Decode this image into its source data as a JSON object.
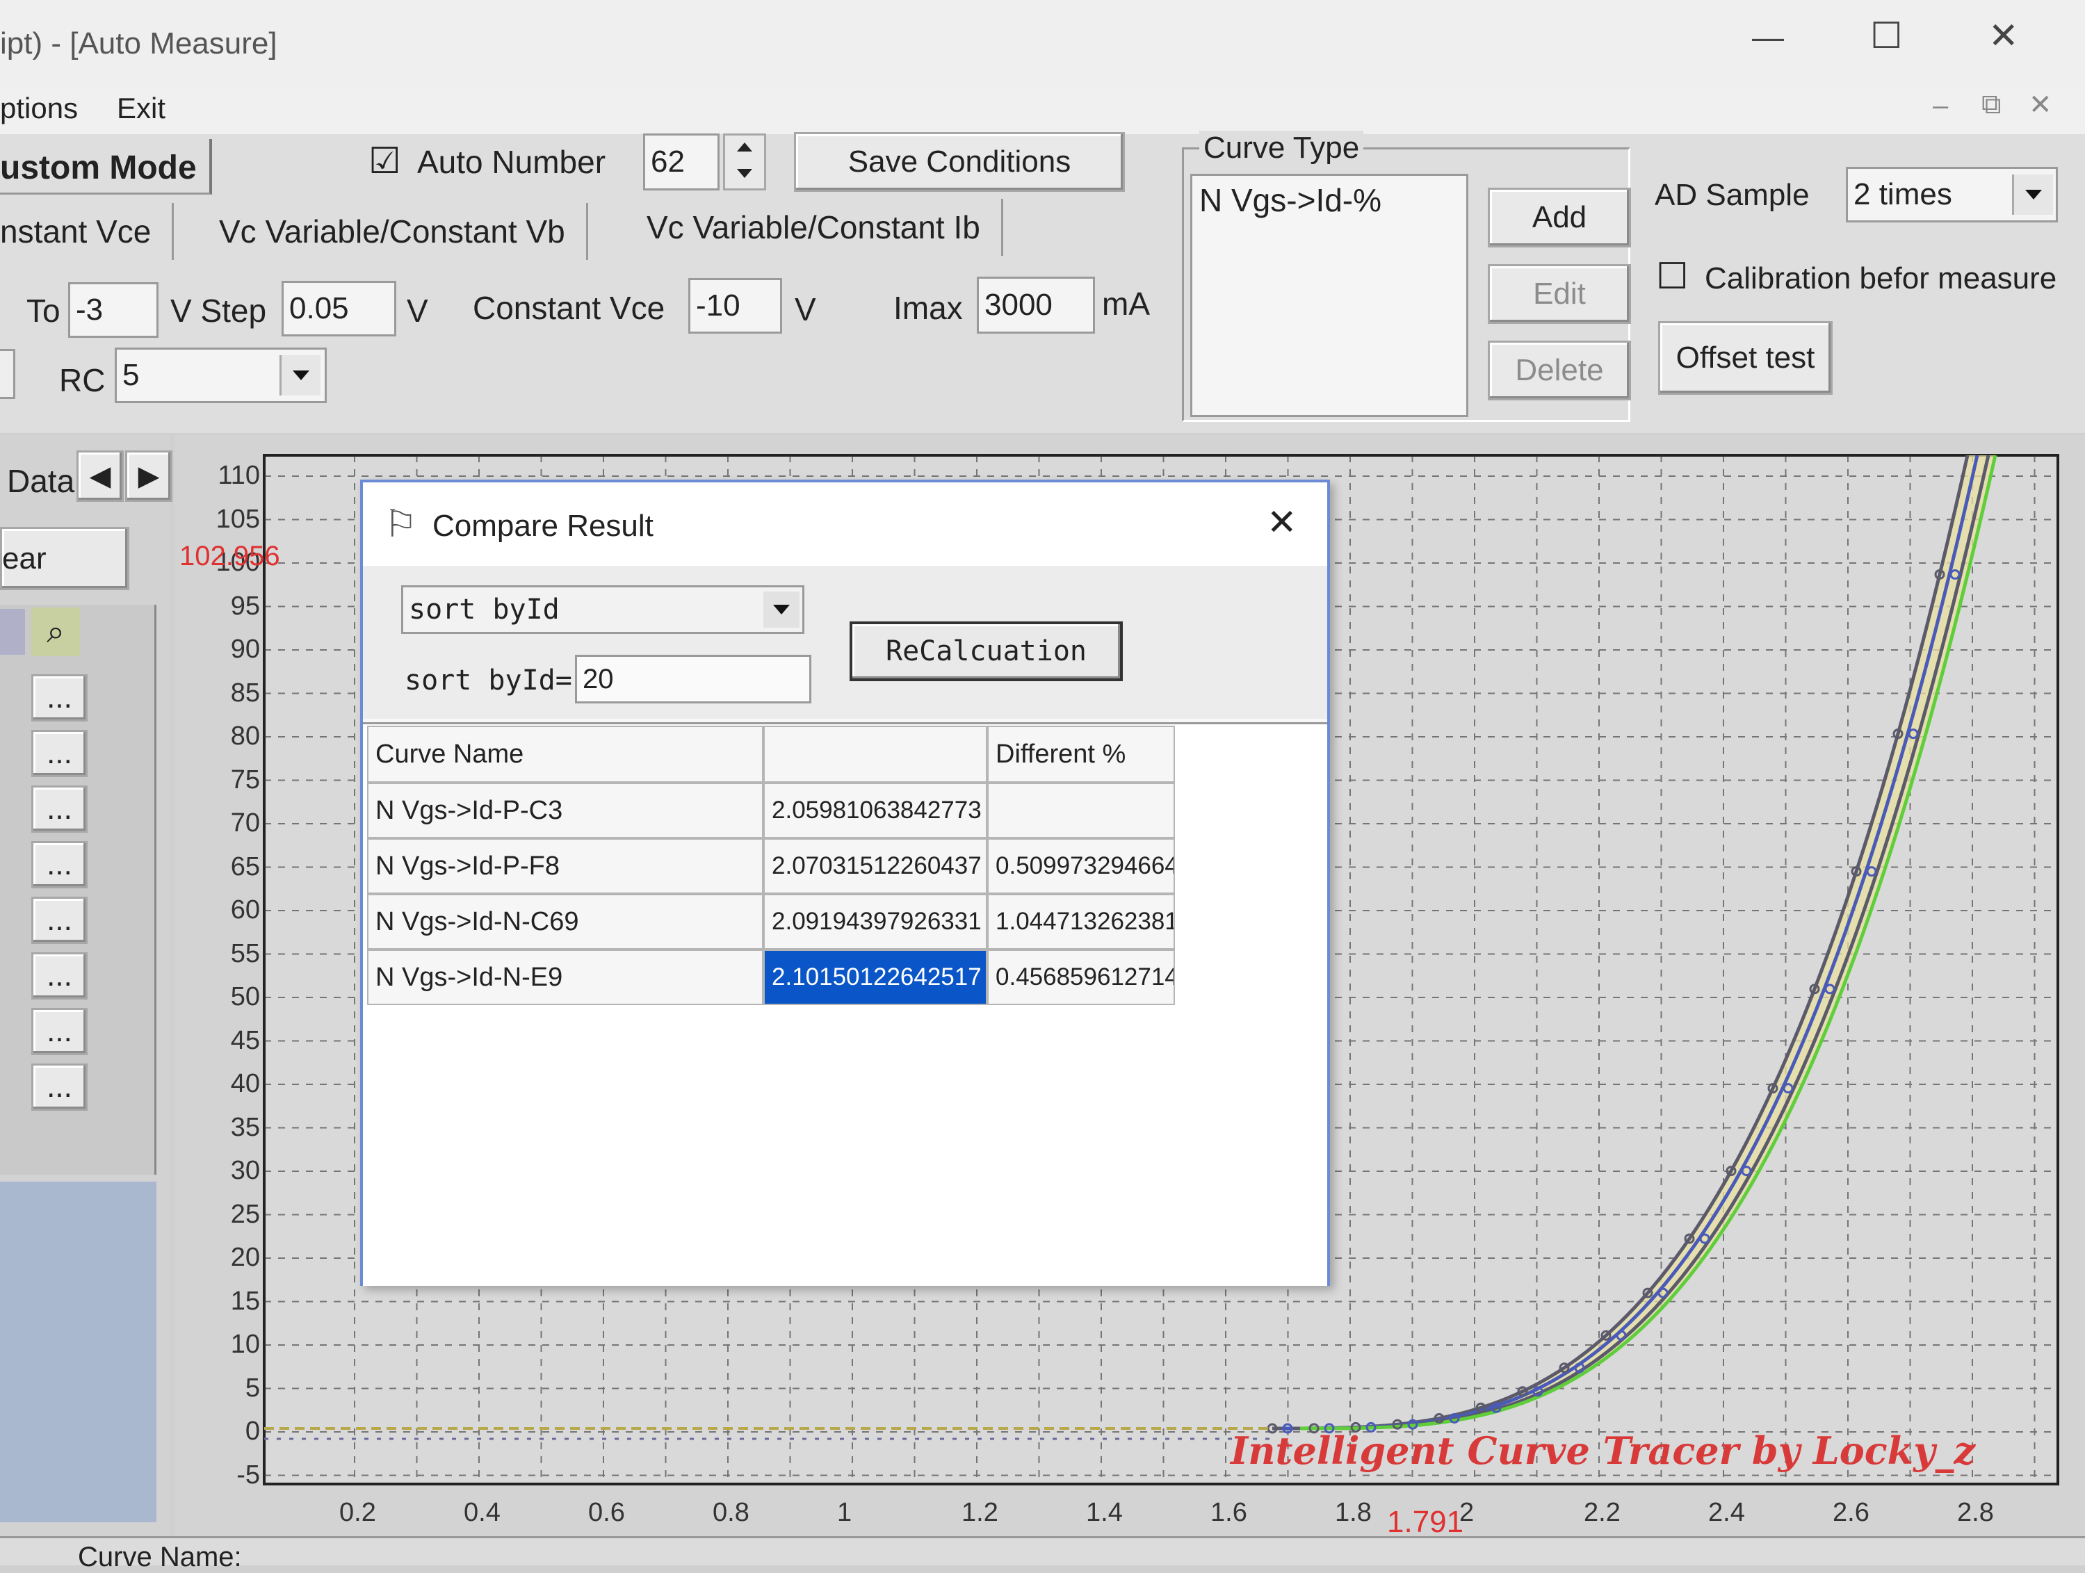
{
  "window": {
    "title": "ipt) - [Auto Measure]",
    "controls": {
      "minimize": "—",
      "maximize": "☐",
      "close": "✕"
    }
  },
  "menu": {
    "options": "ptions",
    "exit": "Exit"
  },
  "mdi_controls": {
    "minimize": "–",
    "restore": "⧉",
    "close": "✕"
  },
  "mode": {
    "label": "ustom Mode"
  },
  "auto_number": {
    "checkbox": "☑",
    "label": "Auto Number",
    "value": "62"
  },
  "save_conditions": "Save Conditions",
  "tabs": [
    "nstant Vce",
    "Vc Variable/Constant Vb",
    "Vc Variable/Constant Ib"
  ],
  "params": {
    "to_label": "To",
    "to_value": "-3",
    "step_label": "V Step",
    "step_value": "0.05",
    "step_unit": "V",
    "vce_label": "Constant Vce",
    "vce_value": "-10",
    "vce_unit": "V",
    "imax_label": "Imax",
    "imax_value": "3000",
    "imax_unit": "mA",
    "rc_label": "RC",
    "rc_value": "5"
  },
  "curve_type": {
    "title": "Curve Type",
    "items": [
      "N Vgs->Id-%"
    ],
    "add": "Add",
    "edit": "Edit",
    "delete": "Delete"
  },
  "ad_sample": {
    "label": "AD Sample",
    "value": "2 times"
  },
  "calibration": {
    "checkbox": "☐",
    "label": "Calibration befor measure"
  },
  "offset_test": "Offset test",
  "left_panel": {
    "data_label": "Data",
    "clear_label": "ear",
    "dots": "..."
  },
  "plot": {
    "y_marker": "102.956",
    "x_marker": "1.791",
    "watermark": "Intelligent Curve Tracer by Locky_z",
    "y_ticks": [
      "110",
      "105",
      "100",
      "95",
      "90",
      "85",
      "80",
      "75",
      "70",
      "65",
      "60",
      "55",
      "50",
      "45",
      "40",
      "35",
      "30",
      "25",
      "20",
      "15",
      "10",
      "5",
      "0",
      "-5"
    ],
    "x_ticks": [
      "0.2",
      "0.4",
      "0.6",
      "0.8",
      "1",
      "1.2",
      "1.4",
      "1.6",
      "1.8",
      "2",
      "2.2",
      "2.4",
      "2.6",
      "2.8"
    ],
    "colors": {
      "trace_dark": "#5a5a6a",
      "trace_green": "#5fce3a",
      "trace_blue": "#4a5ab8",
      "band": "#e8e0a0",
      "marker_red": "#e03030"
    }
  },
  "status": {
    "curve_name": "Curve Name:"
  },
  "dialog": {
    "title": "Compare Result",
    "close": "✕",
    "sort_select": "sort byId",
    "sort_label": "sort byId=",
    "sort_value": "20",
    "recalc": "ReCalcuation",
    "columns": [
      "Curve Name",
      "",
      "Different %"
    ],
    "rows": [
      {
        "name": "N Vgs->Id-P-C3",
        "value": "2.05981063842773",
        "diff": ""
      },
      {
        "name": "N Vgs->Id-P-F8",
        "value": "2.07031512260437",
        "diff": "0.509973294664"
      },
      {
        "name": "N Vgs->Id-N-C69",
        "value": "2.09194397926331",
        "diff": "1.044713262381"
      },
      {
        "name": "N Vgs->Id-N-E9",
        "value": "2.10150122642517",
        "diff": "0.456859612714"
      }
    ]
  }
}
